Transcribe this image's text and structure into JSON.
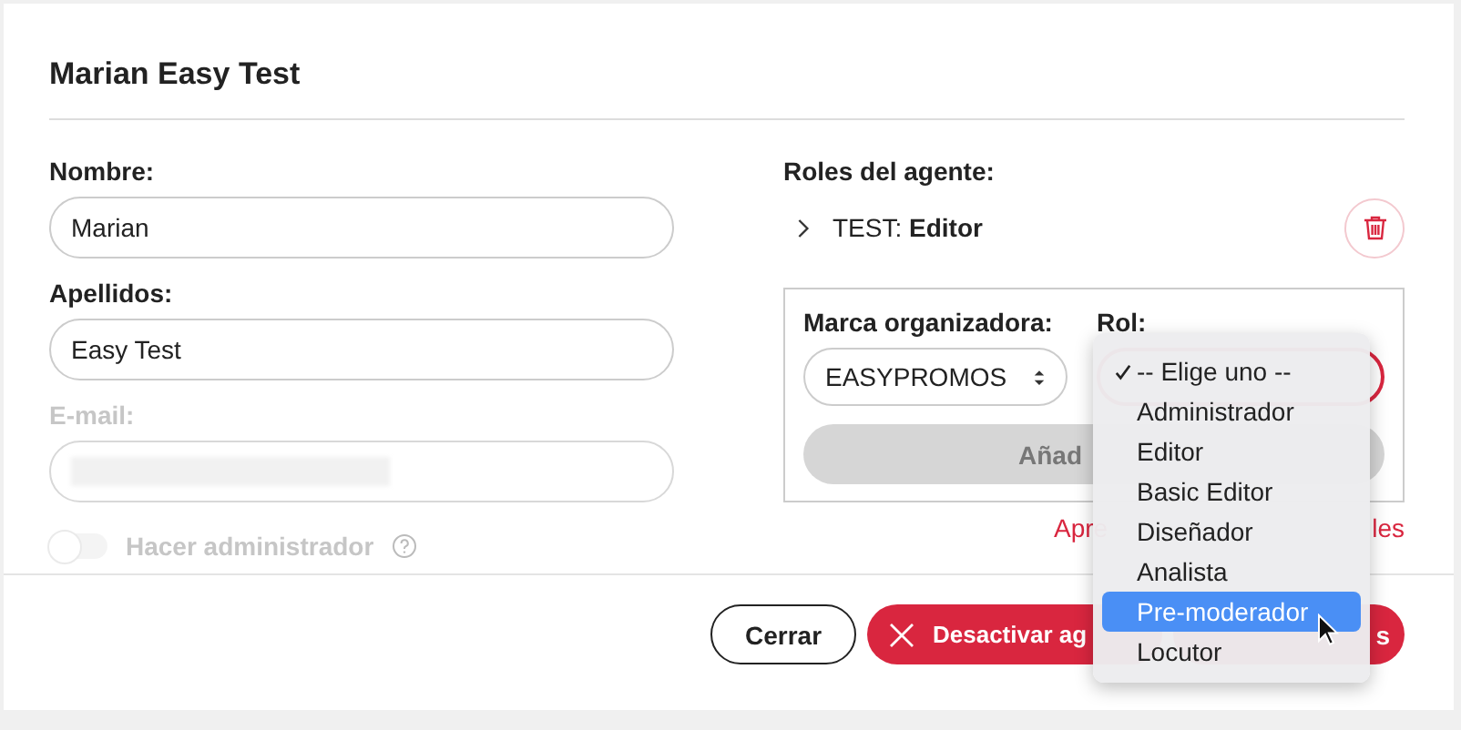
{
  "dialog": {
    "title": "Marian Easy Test"
  },
  "fields": [
    {
      "label": "Nombre:",
      "value": "Marian",
      "disabled": false
    },
    {
      "label": "Apellidos:",
      "value": "Easy Test",
      "disabled": false
    },
    {
      "label": "E-mail:",
      "disabled": true
    }
  ],
  "admin_toggle": {
    "label": "Hacer administrador",
    "on": false,
    "disabled": true
  },
  "roles": {
    "heading": "Roles del agente:",
    "items": [
      {
        "text": "TEST: **Editor**",
        "expanded": false
      }
    ]
  },
  "add_role": {
    "brand_label": "Marca organizadora:",
    "brand_value": "EASYPROMOS",
    "role_label": "Rol:",
    "add_button": "Añad",
    "add_disabled": true
  },
  "role_menu": {
    "options": [
      {
        "label": "-- Elige uno --",
        "checked": true,
        "selected": false
      },
      {
        "label": "Administrador",
        "checked": false,
        "selected": false
      },
      {
        "label": "Editor",
        "checked": false,
        "selected": false
      },
      {
        "label": "Basic Editor",
        "checked": false,
        "selected": false
      },
      {
        "label": "Diseñador",
        "checked": false,
        "selected": false
      },
      {
        "label": "Analista",
        "checked": false,
        "selected": false
      },
      {
        "label": "Pre-moderador",
        "checked": false,
        "selected": true
      },
      {
        "label": "Locutor",
        "checked": false,
        "selected": false
      }
    ]
  },
  "link_parts": [
    "Apre",
    "les"
  ],
  "footer_buttons": [
    {
      "label": "Cerrar",
      "kind": "outline"
    },
    {
      "label": "Desactivar ag",
      "kind": "danger-icon"
    },
    {
      "label": "s",
      "kind": "danger"
    }
  ]
}
